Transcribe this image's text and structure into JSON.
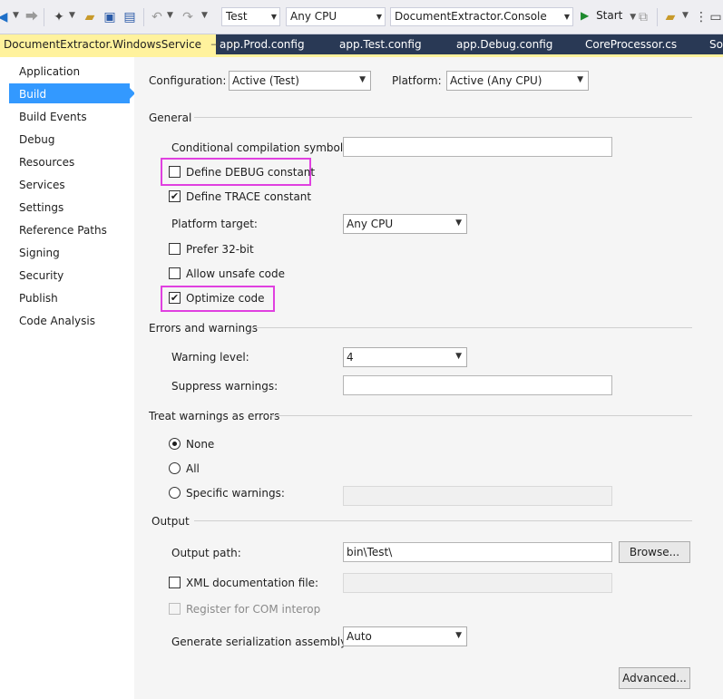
{
  "toolbar": {
    "config_combo": "Test",
    "platform_combo": "Any CPU",
    "startup_combo": "DocumentExtractor.Console",
    "start_label": "Start"
  },
  "tabs": [
    {
      "label": "DocumentExtractor.WindowsService"
    },
    {
      "label": "app.Prod.config"
    },
    {
      "label": "app.Test.config"
    },
    {
      "label": "app.Debug.config"
    },
    {
      "label": "CoreProcessor.cs"
    },
    {
      "label": "So"
    }
  ],
  "sidebar": {
    "items": [
      {
        "label": "Application"
      },
      {
        "label": "Build"
      },
      {
        "label": "Build Events"
      },
      {
        "label": "Debug"
      },
      {
        "label": "Resources"
      },
      {
        "label": "Services"
      },
      {
        "label": "Settings"
      },
      {
        "label": "Reference Paths"
      },
      {
        "label": "Signing"
      },
      {
        "label": "Security"
      },
      {
        "label": "Publish"
      },
      {
        "label": "Code Analysis"
      }
    ]
  },
  "header": {
    "configuration_label": "Configuration:",
    "configuration_value": "Active (Test)",
    "platform_label": "Platform:",
    "platform_value": "Active (Any CPU)"
  },
  "general": {
    "title": "General",
    "cond_symbols_label": "Conditional compilation symbols:",
    "cond_symbols_value": "",
    "define_debug_label": "Define DEBUG constant",
    "define_debug_checked": false,
    "define_trace_label": "Define TRACE constant",
    "define_trace_checked": true,
    "platform_target_label": "Platform target:",
    "platform_target_value": "Any CPU",
    "prefer32_label": "Prefer 32-bit",
    "unsafe_label": "Allow unsafe code",
    "optimize_label": "Optimize code",
    "optimize_checked": true
  },
  "errors": {
    "title": "Errors and warnings",
    "warning_level_label": "Warning level:",
    "warning_level_value": "4",
    "suppress_label": "Suppress warnings:",
    "suppress_value": ""
  },
  "treat": {
    "title": "Treat warnings as errors",
    "none_label": "None",
    "all_label": "All",
    "specific_label": "Specific warnings:",
    "selected": "None"
  },
  "output": {
    "title": "Output",
    "path_label": "Output path:",
    "path_value": "bin\\Test\\",
    "browse_label": "Browse...",
    "xml_doc_label": "XML documentation file:",
    "com_label": "Register for COM interop",
    "serialization_label": "Generate serialization assembly:",
    "serialization_value": "Auto",
    "advanced_label": "Advanced..."
  },
  "colors": {
    "tab_bar": "#293955",
    "active_tab": "#fff29d",
    "selection": "#3399ff",
    "highlight": "#e040e0"
  }
}
